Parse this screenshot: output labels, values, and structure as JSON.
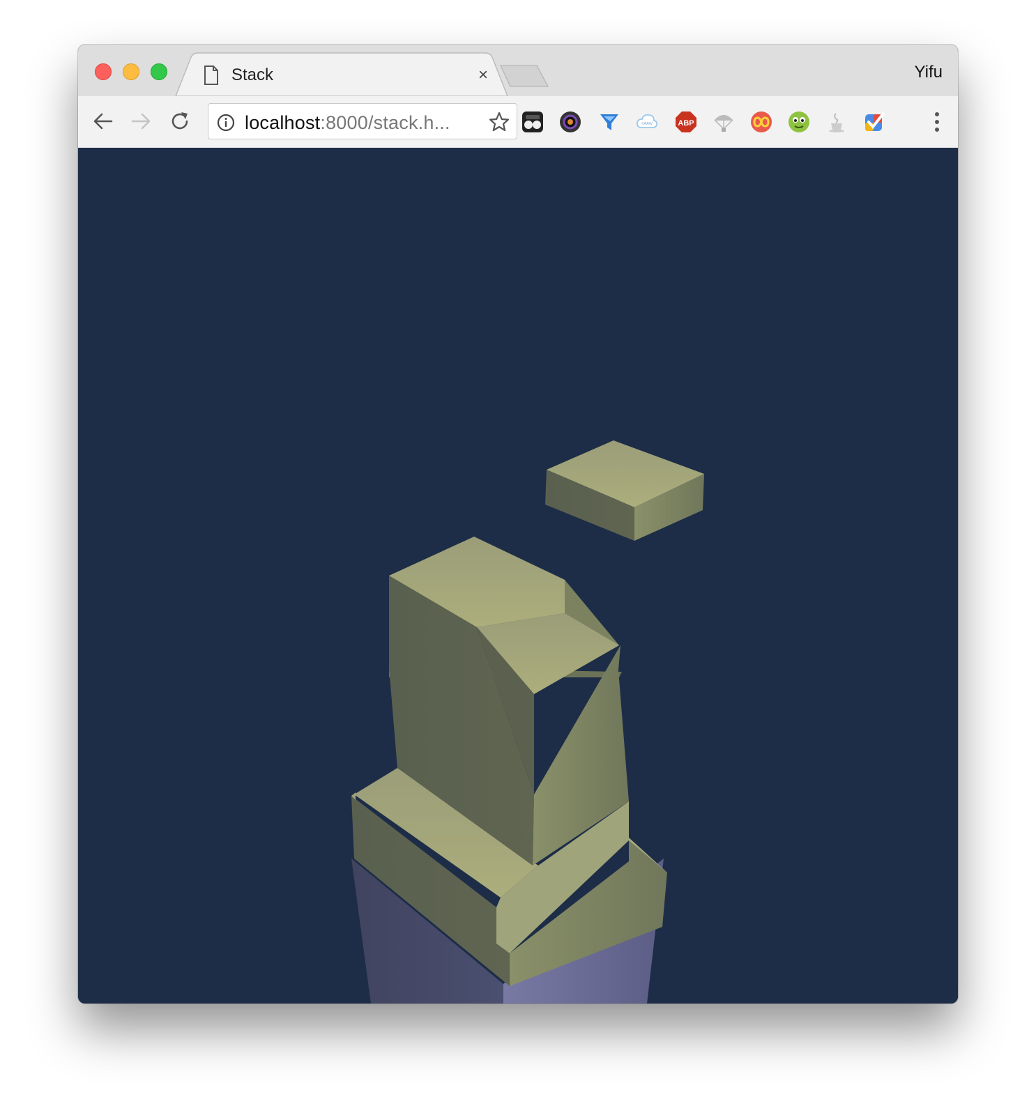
{
  "browser": {
    "tab": {
      "title": "Stack",
      "close_glyph": "×"
    },
    "profile_name": "Yifu",
    "address": {
      "host": "localhost",
      "rest": ":8000/stack.h..."
    },
    "extensions": [
      "incognito-glasses-icon",
      "camera-lens-icon",
      "blue-funnel-icon",
      "yaaw-cloud-icon",
      "adblock-plus-icon",
      "parachute-icon",
      "infinity-icon",
      "green-face-icon",
      "java-cup-icon",
      "color-check-icon"
    ]
  },
  "game": {
    "scene": "stack-blocks",
    "colors": {
      "background": "#1d2d47",
      "block_top": "#a3a67a",
      "block_left": "#5b6050",
      "block_right": "#7c8262",
      "base_left": "#434768",
      "base_right": "#6b6c96"
    }
  }
}
